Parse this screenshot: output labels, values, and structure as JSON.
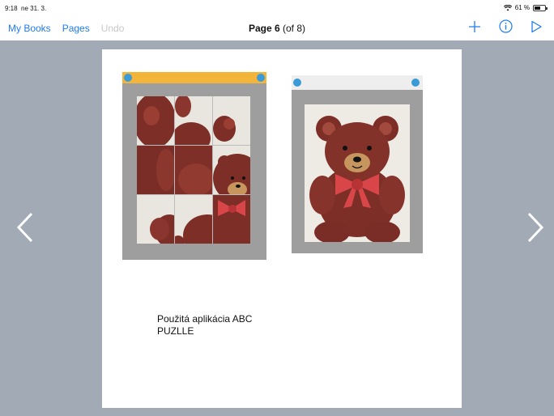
{
  "status": {
    "time": "9:18",
    "date": "ne 31. 3.",
    "battery": "61 %",
    "battery_level": 0.61
  },
  "nav": {
    "my_books": "My Books",
    "pages": "Pages",
    "undo": "Undo",
    "title_bold": "Page 6",
    "title_rest": " (of 8)"
  },
  "icons": [
    "wifi-icon",
    "battery-icon",
    "add-icon",
    "info-icon",
    "play-icon",
    "chevron-left-icon",
    "chevron-right-icon"
  ],
  "colors": {
    "accent": "#1e7cf2",
    "stage": "#a2aab5",
    "puzzle_bar": "#f2b53a"
  },
  "page": {
    "caption_line1": "Použitá aplikácia ABC",
    "caption_line2": "PUZLLE"
  }
}
